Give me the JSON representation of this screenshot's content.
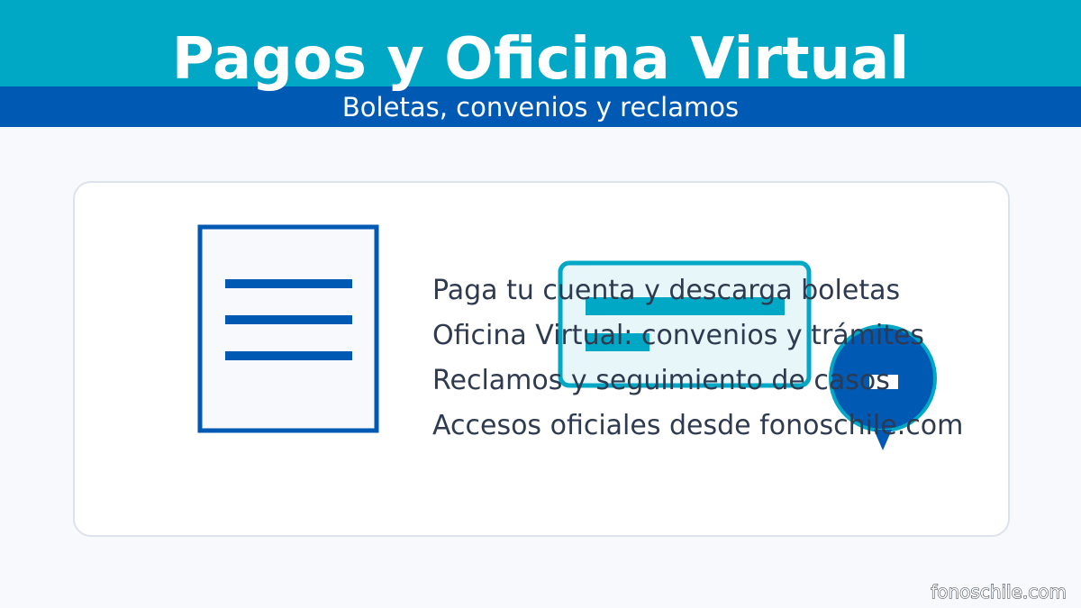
{
  "header": {
    "title": "Pagos y Oficina Virtual",
    "subtitle": "Boletas, convenios y reclamos"
  },
  "features": [
    "Paga tu cuenta y descarga boletas",
    "Oficina Virtual: convenios y trámites",
    "Reclamos y seguimiento de casos",
    "Accesos oficiales desde fonoschile.com"
  ],
  "icons": {
    "document": "document-icon",
    "card": "payment-card-icon",
    "bubble": "chat-bubble-icon"
  },
  "colors": {
    "accent_teal": "#00a8c6",
    "accent_blue": "#0059b3",
    "background": "#f7f9fc",
    "text": "#2e3a4f"
  },
  "footer": {
    "site": "fonoschile.com"
  }
}
